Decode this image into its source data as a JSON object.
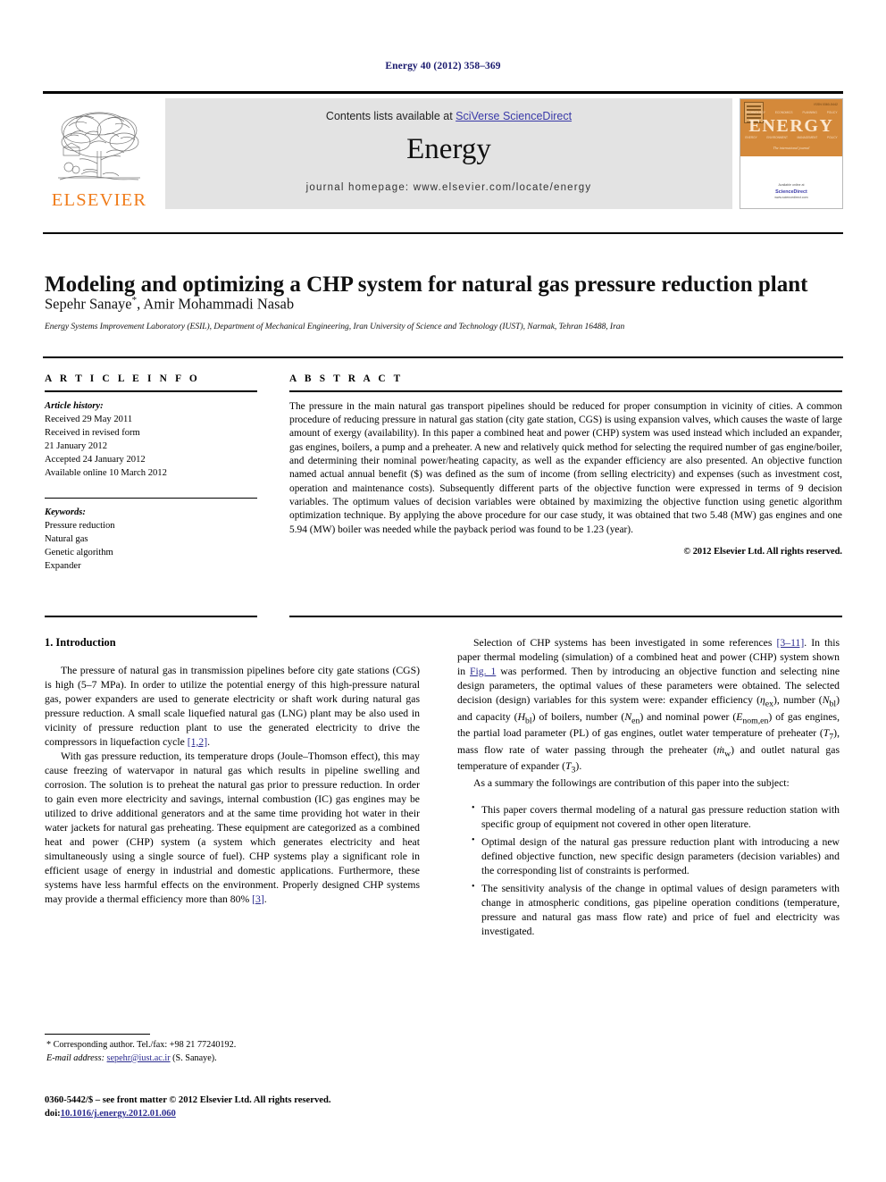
{
  "running_head": "Energy 40 (2012) 358–369",
  "masthead": {
    "contents_prefix": "Contents lists available at ",
    "sciencedirect_link": "SciVerse ScienceDirect",
    "journal_name": "Energy",
    "homepage": "journal homepage: www.elsevier.com/locate/energy",
    "publisher_wordmark": "ELSEVIER",
    "cover": {
      "journal": "ENERGY",
      "subtitle": "The international journal",
      "top_words": [
        "TECHNOLOGY",
        "ECONOMICS",
        "PLANNING",
        "POLICY"
      ],
      "bottom_words": [
        "ENERGY",
        "ENVIRONMENT",
        "MANAGEMENT",
        "POLICY"
      ],
      "issn_code": "ISSN 0360-5442",
      "available_online": "Available online at",
      "sciencedirect": "ScienceDirect",
      "sd_url": "www.sciencedirect.com"
    }
  },
  "article": {
    "title": "Modeling and optimizing a CHP system for natural gas pressure reduction plant",
    "authors_part1": "Sepehr Sanaye",
    "authors_star": "*",
    "authors_part2": ", Amir Mohammadi Nasab",
    "affiliation": "Energy Systems Improvement Laboratory (ESIL), Department of Mechanical Engineering, Iran University of Science and Technology (IUST), Narmak, Tehran 16488, Iran"
  },
  "article_info": {
    "heading": "A R T I C L E   I N F O",
    "history_label": "Article history:",
    "history": [
      "Received 29 May 2011",
      "Received in revised form",
      "21 January 2012",
      "Accepted 24 January 2012",
      "Available online 10 March 2012"
    ],
    "keywords_label": "Keywords:",
    "keywords": [
      "Pressure reduction",
      "Natural gas",
      "Genetic algorithm",
      "Expander"
    ]
  },
  "abstract": {
    "heading": "A B S T R A C T",
    "text": "The pressure in the main natural gas transport pipelines should be reduced for proper consumption in vicinity of cities. A common procedure of reducing pressure in natural gas station (city gate station, CGS) is using expansion valves, which causes the waste of large amount of exergy (availability). In this paper a combined heat and power (CHP) system was used instead which included an expander, gas engines, boilers, a pump and a preheater. A new and relatively quick method for selecting the required number of gas engine/boiler, and determining their nominal power/heating capacity, as well as the expander efficiency are also presented. An objective function named actual annual benefit ($) was defined as the sum of income (from selling electricity) and expenses (such as investment cost, operation and maintenance costs). Subsequently different parts of the objective function were expressed in terms of 9 decision variables. The optimum values of decision variables were obtained by maximizing the objective function using genetic algorithm optimization technique. By applying the above procedure for our case study, it was obtained that two 5.48 (MW) gas engines and one 5.94 (MW) boiler was needed while the payback period was found to be 1.23 (year).",
    "copyright": "© 2012 Elsevier Ltd. All rights reserved."
  },
  "introduction": {
    "section_title": "1. Introduction",
    "p1_a": "The pressure of natural gas in transmission pipelines before city gate stations (CGS) is high (5–7 MPa). In order to utilize the potential energy of this high-pressure natural gas, power expanders are used to generate electricity or shaft work during natural gas pressure reduction. A small scale liquefied natural gas (LNG) plant may be also used in vicinity of pressure reduction plant to use the generated electricity to drive the compressors in liquefaction cycle ",
    "p1_ref": "[1,2]",
    "p1_b": ".",
    "p2_a": "With gas pressure reduction, its temperature drops (Joule–Thomson effect), this may cause freezing of watervapor in natural gas which results in pipeline swelling and corrosion. The solution is to preheat the natural gas prior to pressure reduction. In order to gain even more electricity and savings, internal combustion (IC) gas engines may be utilized to drive additional generators and at the same time providing hot water in their water jackets for natural gas preheating. These equipment are categorized as a combined heat and power (CHP) system (a system which generates electricity and heat simultaneously using a single source of fuel). CHP systems play a significant role in efficient usage of energy in industrial and domestic applications. Furthermore, these systems have less harmful effects on the environment. Properly designed CHP systems may provide a thermal efficiency more than 80% ",
    "p2_ref": "[3]",
    "p2_b": ".",
    "r1_a": "Selection of CHP systems has been investigated in some references ",
    "r1_ref1": "[3–11]",
    "r1_b": ". In this paper thermal modeling (simulation) of a combined heat and power (CHP) system shown in ",
    "r1_fig": "Fig. 1",
    "r1_c": " was performed. Then by introducing an objective function and selecting nine design parameters, the optimal values of these parameters were obtained. The selected decision (design) variables for this system were: expander efficiency (",
    "r1_var1": "η",
    "r1_var1_sub": "ex",
    "r1_d": "), number (",
    "r1_var2": "N",
    "r1_var2_sub": "bl",
    "r1_e": ") and capacity (",
    "r1_var3": "H",
    "r1_var3_sub": "bl",
    "r1_f": ") of boilers, number (",
    "r1_var4": "N",
    "r1_var4_sub": "en",
    "r1_g": ") and nominal power (",
    "r1_var5": "E",
    "r1_var5_sub": "nom,en",
    "r1_h": ") of gas engines, the partial load parameter (PL) of gas engines, outlet water temperature of preheater (",
    "r1_var6": "T",
    "r1_var6_sub": "7",
    "r1_i": "), mass flow rate of water passing through the preheater (",
    "r1_var7": "ṁ",
    "r1_var7_sub": "w",
    "r1_j": ") and outlet natural gas temperature of expander (",
    "r1_var8": "T",
    "r1_var8_sub": "3",
    "r1_k": ").",
    "r2": "As a summary the followings are contribution of this paper into the subject:",
    "bullets": [
      "This paper covers thermal modeling of a natural gas pressure reduction station with specific group of equipment not covered in other open literature.",
      "Optimal design of the natural gas pressure reduction plant with introducing a new defined objective function, new specific design parameters (decision variables) and the corresponding list of constraints is performed.",
      "The sensitivity analysis of the change in optimal values of design parameters with change in atmospheric conditions, gas pipeline operation conditions (temperature, pressure and natural gas mass flow rate) and price of fuel and electricity was investigated."
    ]
  },
  "footer": {
    "corresponding_star": "*",
    "corresponding": " Corresponding author. Tel./fax: +98 21 77240192.",
    "email_label": "E-mail address:",
    "email": "sepehr@iust.ac.ir",
    "email_suffix": " (S. Sanaye).",
    "imprint": "0360-5442/$ – see front matter © 2012 Elsevier Ltd. All rights reserved.",
    "doi_label": "doi:",
    "doi": "10.1016/j.energy.2012.01.060"
  },
  "colors": {
    "link": "#3a3aa8",
    "reference": "#2b2b8f",
    "elsevier_orange": "#f07c1a",
    "cover_orange": "#d4893a",
    "banner_gray": "#e3e3e3",
    "running_head": "#1a1a6e"
  }
}
